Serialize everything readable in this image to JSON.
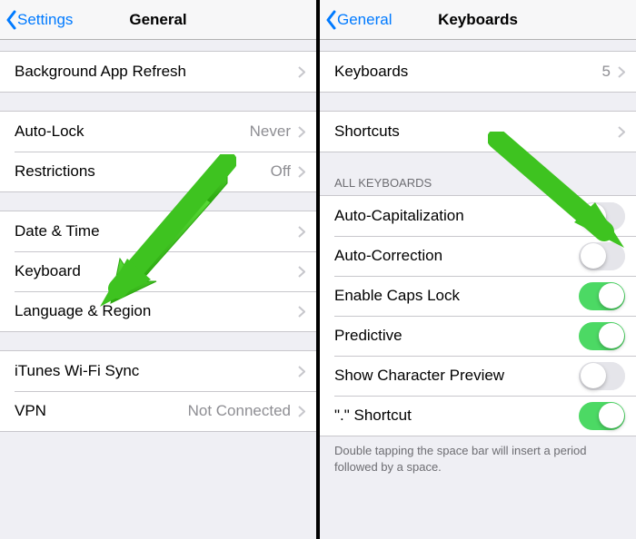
{
  "left": {
    "nav": {
      "back": "Settings",
      "title": "General"
    },
    "groups": [
      {
        "items": [
          {
            "label": "Background App Refresh",
            "value": ""
          }
        ]
      },
      {
        "items": [
          {
            "label": "Auto-Lock",
            "value": "Never"
          },
          {
            "label": "Restrictions",
            "value": "Off"
          }
        ]
      },
      {
        "items": [
          {
            "label": "Date & Time",
            "value": ""
          },
          {
            "label": "Keyboard",
            "value": ""
          },
          {
            "label": "Language & Region",
            "value": ""
          }
        ]
      },
      {
        "items": [
          {
            "label": "iTunes Wi-Fi Sync",
            "value": ""
          },
          {
            "label": "VPN",
            "value": "Not Connected"
          }
        ]
      }
    ]
  },
  "right": {
    "nav": {
      "back": "General",
      "title": "Keyboards"
    },
    "group0": {
      "items": [
        {
          "label": "Keyboards",
          "value": "5"
        }
      ]
    },
    "group1": {
      "items": [
        {
          "label": "Shortcuts",
          "value": ""
        }
      ]
    },
    "group2": {
      "header": "ALL KEYBOARDS",
      "switches": [
        {
          "label": "Auto-Capitalization",
          "on": false
        },
        {
          "label": "Auto-Correction",
          "on": false
        },
        {
          "label": "Enable Caps Lock",
          "on": true
        },
        {
          "label": "Predictive",
          "on": true
        },
        {
          "label": "Show Character Preview",
          "on": false
        },
        {
          "label": "\".\" Shortcut",
          "on": true
        }
      ],
      "footer": "Double tapping the space bar will insert a period followed by a space."
    }
  },
  "annotations": {
    "arrow_color": "#3ec320"
  }
}
